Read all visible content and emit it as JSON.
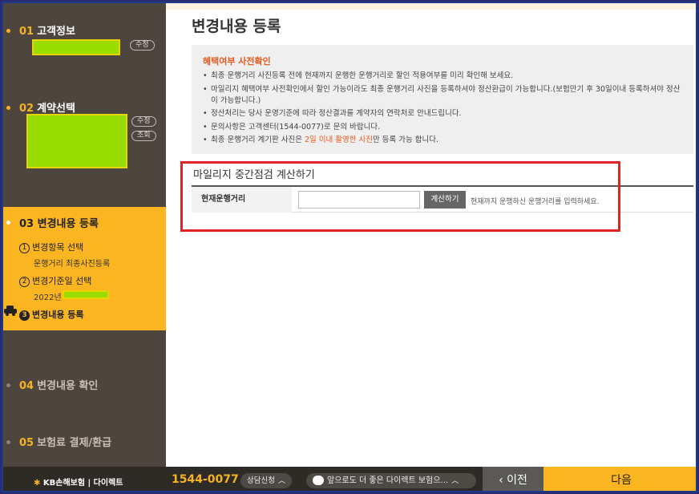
{
  "sidebar": {
    "step1": {
      "num": "01",
      "label": "고객정보",
      "edit": "수정"
    },
    "step2": {
      "num": "02",
      "label": "계약선택",
      "edit": "수정",
      "view": "조회"
    },
    "step3": {
      "num": "03",
      "label": "변경내용 등록",
      "sub1": {
        "num": "1",
        "label": "변경항목 선택",
        "detail": "운행거리 최종사진등록"
      },
      "sub2": {
        "num": "2",
        "label": "변경기준일 선택",
        "detail": "2022년"
      },
      "sub3": {
        "num": "3",
        "label": "변경내용 등록"
      }
    },
    "step4": {
      "num": "04",
      "label": "변경내용 확인"
    },
    "step5": {
      "num": "05",
      "label": "보험료 결제/환급"
    }
  },
  "main": {
    "title": "변경내용 등록",
    "notice": {
      "title": "혜택여부 사전확인",
      "items": [
        "최종 운행거리 사진등록 전에 현재까지 운행한 운행거리로 할인 적용여부를 미리 확인해 보세요.",
        "마일리지 혜택여부 사전확인에서 할인 가능이라도 최종 운행거리 사진을 등록하셔야 정산환급이 가능합니다.(보험만기 후 30일이내 등록하셔야 정산이 가능합니다.)",
        "정산처리는 당사 운영기준에 따라 정산결과를 계약자의 연락처로 안내드립니다.",
        "문의사항은 고객센터(1544-0077)로 문의 바랍니다."
      ],
      "last_item": {
        "before": "최종 운행거리 계기판 사진은 ",
        "highlight": "2일 이내 촬영한 사진",
        "after": "만 등록 가능 합니다."
      }
    },
    "calc": {
      "title": "마일리지 중간점검 계산하기",
      "label": "현재운행거리",
      "input_value": "",
      "button": "계산하기",
      "help": "현재까지 운행하신 운행거리를 입력하세요."
    }
  },
  "footer": {
    "logo": "KB손해보험 | 다이렉트",
    "phone": "1544-0077",
    "consult": "상담신청",
    "chat": "앞으로도 더 좋은 다이렉트 보험으...",
    "prev": "이전",
    "next": "다음"
  },
  "colors": {
    "accent": "#fbb521",
    "sidebar": "#4d463f",
    "highlight_border": "#e02424",
    "notice_title": "#e85a1e"
  }
}
